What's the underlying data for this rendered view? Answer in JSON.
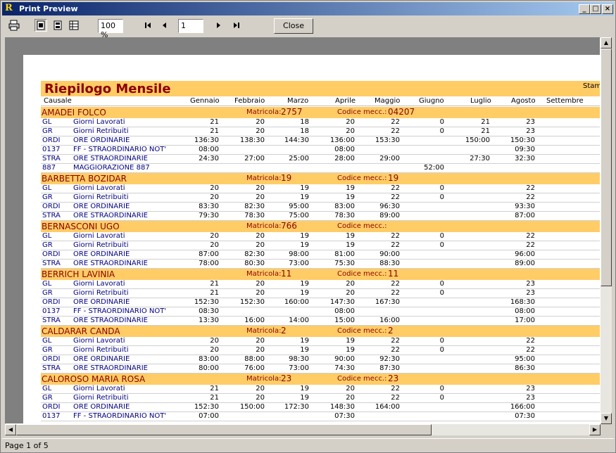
{
  "window": {
    "title": "Print Preview",
    "app_icon": "R",
    "controls": {
      "minimize": "_",
      "maximize": "□",
      "close": "×"
    }
  },
  "toolbar": {
    "zoom": "100 %",
    "page": "1",
    "close_label": "Close"
  },
  "status": {
    "text": "Page 1 of 5"
  },
  "report": {
    "title": "Riepilogo Mensile",
    "stamp": "Stam",
    "headers": [
      "Causale",
      "Gennaio",
      "Febbraio",
      "Marzo",
      "Aprile",
      "Maggio",
      "Giugno",
      "Luglio",
      "Agosto",
      "Settembre"
    ],
    "matricola_label": "Matricola:",
    "codice_label": "Codice mecc.:",
    "employees": [
      {
        "name": "AMADEI FOLCO",
        "matricola": "2757",
        "codice": "04207",
        "rows": [
          [
            "GL",
            "Giorni Lavorati",
            "21",
            "20",
            "18",
            "20",
            "22",
            "0",
            "21",
            "23"
          ],
          [
            "GR",
            "Giorni Retribuiti",
            "21",
            "20",
            "18",
            "20",
            "22",
            "0",
            "21",
            "23"
          ],
          [
            "ORDI",
            "ORE ORDINARIE",
            "136:30",
            "138:30",
            "144:30",
            "136:00",
            "153:30",
            "",
            "150:00",
            "150:30"
          ],
          [
            "0137",
            "FF - STRAORDINARIO NOT'",
            "08:00",
            "",
            "",
            "08:00",
            "",
            "",
            "",
            "09:30"
          ],
          [
            "STRA",
            "ORE STRAORDINARIE",
            "24:30",
            "27:00",
            "25:00",
            "28:00",
            "29:00",
            "",
            "27:30",
            "32:30"
          ],
          [
            "887",
            "MAGGIORAZIONE 887",
            "",
            "",
            "",
            "",
            "",
            "52:00",
            "",
            ""
          ]
        ]
      },
      {
        "name": "BARBETTA BOZIDAR",
        "matricola": "19",
        "codice": "19",
        "rows": [
          [
            "GL",
            "Giorni Lavorati",
            "20",
            "20",
            "19",
            "19",
            "22",
            "0",
            "",
            "22"
          ],
          [
            "GR",
            "Giorni Retribuiti",
            "20",
            "20",
            "19",
            "19",
            "22",
            "0",
            "",
            "22"
          ],
          [
            "ORDI",
            "ORE ORDINARIE",
            "83:30",
            "82:30",
            "95:00",
            "83:00",
            "96:30",
            "",
            "",
            "93:30"
          ],
          [
            "STRA",
            "ORE STRAORDINARIE",
            "79:30",
            "78:30",
            "75:00",
            "78:30",
            "89:00",
            "",
            "",
            "87:00"
          ]
        ]
      },
      {
        "name": "BERNASCONI UGO",
        "matricola": "766",
        "codice": "",
        "rows": [
          [
            "GL",
            "Giorni Lavorati",
            "20",
            "20",
            "19",
            "19",
            "22",
            "0",
            "",
            "22"
          ],
          [
            "GR",
            "Giorni Retribuiti",
            "20",
            "20",
            "19",
            "19",
            "22",
            "0",
            "",
            "22"
          ],
          [
            "ORDI",
            "ORE ORDINARIE",
            "87:00",
            "82:30",
            "98:00",
            "81:00",
            "90:00",
            "",
            "",
            "96:00"
          ],
          [
            "STRA",
            "ORE STRAORDINARIE",
            "78:00",
            "80:30",
            "73:00",
            "75:30",
            "88:30",
            "",
            "",
            "89:00"
          ]
        ]
      },
      {
        "name": "BERRICH LAVINIA",
        "matricola": "11",
        "codice": "11",
        "rows": [
          [
            "GL",
            "Giorni Lavorati",
            "21",
            "20",
            "19",
            "20",
            "22",
            "0",
            "",
            "23"
          ],
          [
            "GR",
            "Giorni Retribuiti",
            "21",
            "20",
            "19",
            "20",
            "22",
            "0",
            "",
            "23"
          ],
          [
            "ORDI",
            "ORE ORDINARIE",
            "152:30",
            "152:30",
            "160:00",
            "147:30",
            "167:30",
            "",
            "",
            "168:30"
          ],
          [
            "0137",
            "FF - STRAORDINARIO NOT'",
            "08:30",
            "",
            "",
            "08:00",
            "",
            "",
            "",
            "08:00"
          ],
          [
            "STRA",
            "ORE STRAORDINARIE",
            "13:30",
            "16:00",
            "14:00",
            "15:00",
            "16:00",
            "",
            "",
            "17:00"
          ]
        ]
      },
      {
        "name": "CALDARAR CANDA",
        "matricola": "2",
        "codice": "2",
        "rows": [
          [
            "GL",
            "Giorni Lavorati",
            "20",
            "20",
            "19",
            "19",
            "22",
            "0",
            "",
            "22"
          ],
          [
            "GR",
            "Giorni Retribuiti",
            "20",
            "20",
            "19",
            "19",
            "22",
            "0",
            "",
            "22"
          ],
          [
            "ORDI",
            "ORE ORDINARIE",
            "83:00",
            "88:00",
            "98:30",
            "90:00",
            "92:30",
            "",
            "",
            "95:00"
          ],
          [
            "STRA",
            "ORE STRAORDINARIE",
            "80:00",
            "76:00",
            "73:00",
            "74:30",
            "87:30",
            "",
            "",
            "86:30"
          ]
        ]
      },
      {
        "name": "CALOROSO MARIA ROSA",
        "matricola": "23",
        "codice": "23",
        "rows": [
          [
            "GL",
            "Giorni Lavorati",
            "21",
            "20",
            "19",
            "20",
            "22",
            "0",
            "",
            "23"
          ],
          [
            "GR",
            "Giorni Retribuiti",
            "21",
            "20",
            "19",
            "20",
            "22",
            "0",
            "",
            "23"
          ],
          [
            "ORDI",
            "ORE ORDINARIE",
            "152:30",
            "150:00",
            "172:30",
            "148:30",
            "164:00",
            "",
            "",
            "166:00"
          ],
          [
            "0137",
            "FF - STRAORDINARIO NOT'",
            "07:00",
            "",
            "",
            "07:30",
            "",
            "",
            "",
            "07:30"
          ]
        ]
      }
    ]
  }
}
